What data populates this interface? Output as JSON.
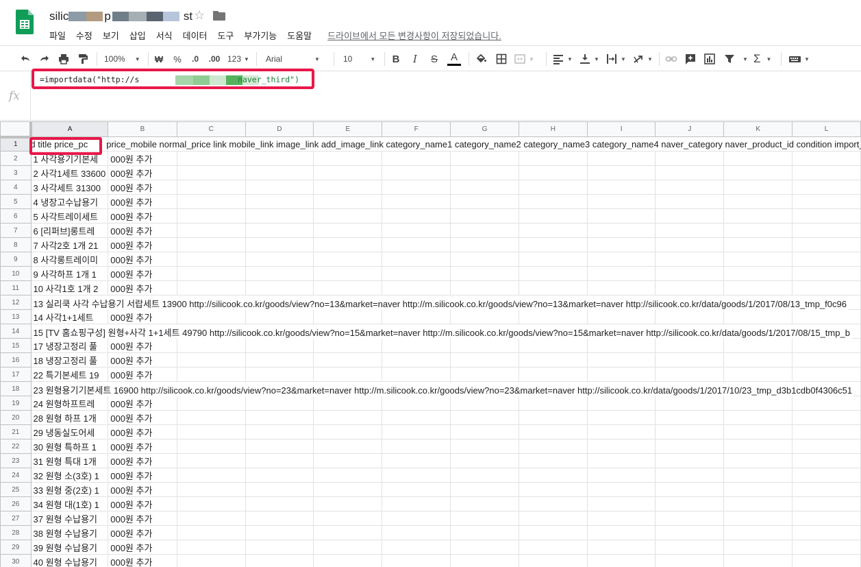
{
  "app": {
    "title_prefix": "silic",
    "title_suffix": "st",
    "title_mid": "p",
    "save_status": "드라이브에서 모든 변경사항이 저장되었습니다."
  },
  "menu": [
    "파일",
    "수정",
    "보기",
    "삽입",
    "서식",
    "데이터",
    "도구",
    "부가기능",
    "도움말"
  ],
  "toolbar": {
    "zoom": "100%",
    "currency": "₩",
    "percent": "%",
    "decrease_decimal": ".0",
    "increase_decimal": ".00",
    "more_formats": "123",
    "font": "Arial",
    "font_size": "10"
  },
  "formula": {
    "fx": "fx",
    "prefix": "=importdata(\"http://s",
    "suffix": "naver_third\")"
  },
  "columns": [
    "A",
    "B",
    "C",
    "D",
    "E",
    "F",
    "G",
    "H",
    "I",
    "J",
    "K",
    "L"
  ],
  "header_row": {
    "a": "id title price_pc",
    "rest": "price_mobile normal_price link mobile_link image_link add_image_link category_name1 category_name2 category_name3 category_name4 naver_category naver_product_id condition import_fla"
  },
  "rows": [
    {
      "n": "2",
      "a": "1 사각용기기본세",
      "b": "000원 추가"
    },
    {
      "n": "3",
      "a": "2 사각1세트 33600",
      "b": "000원 추가"
    },
    {
      "n": "4",
      "a": "3 사각세트 31300",
      "b": "000원 추가"
    },
    {
      "n": "5",
      "a": "4 냉장고수납용기",
      "b": "000원 추가"
    },
    {
      "n": "6",
      "a": "5 사각트레이세트",
      "b": "000원 추가"
    },
    {
      "n": "7",
      "a": "6 [리퍼브]롱트레",
      "b": "000원 추가"
    },
    {
      "n": "8",
      "a": "7 사각2호 1개 21",
      "b": "000원 추가"
    },
    {
      "n": "9",
      "a": "8 사각롱트레이미",
      "b": "000원 추가"
    },
    {
      "n": "10",
      "a": "9 사각하프 1개 1",
      "b": "000원 추가"
    },
    {
      "n": "11",
      "a": "10 사각1호 1개 2",
      "b": "000원 추가"
    },
    {
      "n": "12",
      "wide": "13 실리쿡 사각 수납용기 서랍세트 13900   http://silicook.co.kr/goods/view?no=13&market=naver http://m.silicook.co.kr/goods/view?no=13&market=naver http://silicook.co.kr/data/goods/1/2017/08/13_tmp_f0c96"
    },
    {
      "n": "13",
      "a": "14 사각1+1세트 ",
      "b": "000원 추가"
    },
    {
      "n": "14",
      "wide": "15 [TV 홈쇼핑구성] 원형+사각 1+1세트 49790   http://silicook.co.kr/goods/view?no=15&market=naver http://m.silicook.co.kr/goods/view?no=15&market=naver http://silicook.co.kr/data/goods/1/2017/08/15_tmp_b"
    },
    {
      "n": "15",
      "a": "17 냉장고정리 풀",
      "b": "000원 추가"
    },
    {
      "n": "16",
      "a": "18 냉장고정리 풀",
      "b": "000원 추가"
    },
    {
      "n": "17",
      "a": "22 특기본세트 19",
      "b": "000원 추가"
    },
    {
      "n": "18",
      "wide": "23 원형용기기본세트 16900   http://silicook.co.kr/goods/view?no=23&market=naver http://m.silicook.co.kr/goods/view?no=23&market=naver http://silicook.co.kr/data/goods/1/2017/10/23_tmp_d3b1cdb0f4306c51"
    },
    {
      "n": "19",
      "a": "24 원형하프트레",
      "b": "000원 추가"
    },
    {
      "n": "20",
      "a": "28 원형 하프 1개",
      "b": "000원 추가"
    },
    {
      "n": "21",
      "a": "29 냉동실도어세",
      "b": "000원 추가"
    },
    {
      "n": "22",
      "a": "30 원형 특하프 1",
      "b": "000원 추가"
    },
    {
      "n": "23",
      "a": "31 원형 특대 1개",
      "b": "000원 추가"
    },
    {
      "n": "24",
      "a": "32 원형 소(3호) 1",
      "b": "000원 추가"
    },
    {
      "n": "25",
      "a": "33 원형 중(2호) 1",
      "b": "000원 추가"
    },
    {
      "n": "26",
      "a": "34 원형 대(1호) 1",
      "b": "000원 추가"
    },
    {
      "n": "27",
      "a": "37 원형 수납용기",
      "b": "000원 추가"
    },
    {
      "n": "28",
      "a": "38 원형 수납용기",
      "b": "000원 추가"
    },
    {
      "n": "29",
      "a": "39 원형 수납용기",
      "b": "000원 추가"
    },
    {
      "n": "30",
      "a": "40 원형 수납용기",
      "b": "000원 추가"
    }
  ],
  "colors": {
    "highlight": "#e8174a",
    "selection": "#1a73e8",
    "formula_string": "#188038",
    "sheets_green": "#0f9d58"
  },
  "icons": [
    "sheets-logo-icon",
    "star-icon",
    "folder-icon",
    "undo-icon",
    "redo-icon",
    "print-icon",
    "paint-format-icon",
    "bold-icon",
    "italic-icon",
    "strikethrough-icon",
    "text-color-icon",
    "fill-color-icon",
    "borders-icon",
    "merge-icon",
    "align-left-icon",
    "valign-bottom-icon",
    "wrap-icon",
    "rotate-icon",
    "link-icon",
    "comment-icon",
    "chart-icon",
    "filter-icon",
    "functions-icon",
    "input-tools-icon"
  ]
}
